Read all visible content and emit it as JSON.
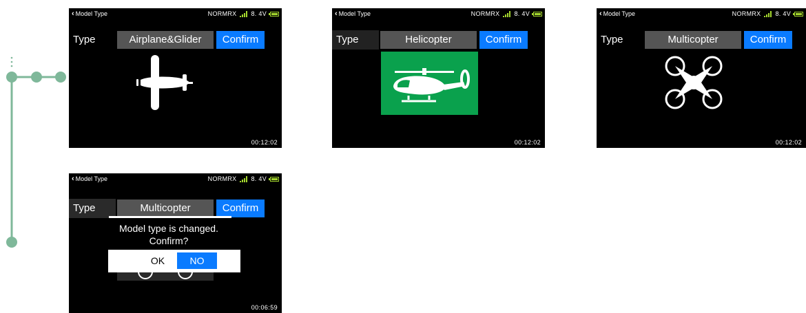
{
  "screens": [
    {
      "header_title": "Model Type",
      "status_mode": "NORMRX",
      "battery_voltage": "8. 4V",
      "type_label": "Type",
      "type_value": "Airplane&Glider",
      "confirm_label": "Confirm",
      "clock": "00:12:02",
      "icon": "airplane-icon"
    },
    {
      "header_title": "Model Type",
      "status_mode": "NORMRX",
      "battery_voltage": "8. 4V",
      "type_label": "Type",
      "type_value": "Helicopter",
      "confirm_label": "Confirm",
      "clock": "00:12:02",
      "icon": "helicopter-icon",
      "icon_tile_color": "#0aa14d"
    },
    {
      "header_title": "Model Type",
      "status_mode": "NORMRX",
      "battery_voltage": "8. 4V",
      "type_label": "Type",
      "type_value": "Multicopter",
      "confirm_label": "Confirm",
      "clock": "00:12:02",
      "icon": "multicopter-icon"
    },
    {
      "header_title": "Model Type",
      "status_mode": "NORMRX",
      "battery_voltage": "8. 4V",
      "type_label": "Type",
      "type_value": "Multicopter",
      "confirm_label": "Confirm",
      "clock": "00:06:59",
      "dialog": {
        "message_line1": "Model type is changed.",
        "message_line2": "Confirm?",
        "ok_label": "OK",
        "no_label": "NO"
      }
    }
  ],
  "colors": {
    "accent_blue": "#0a7bff",
    "connector_green": "#7fb89a",
    "signal_green": "#a5d82e"
  }
}
